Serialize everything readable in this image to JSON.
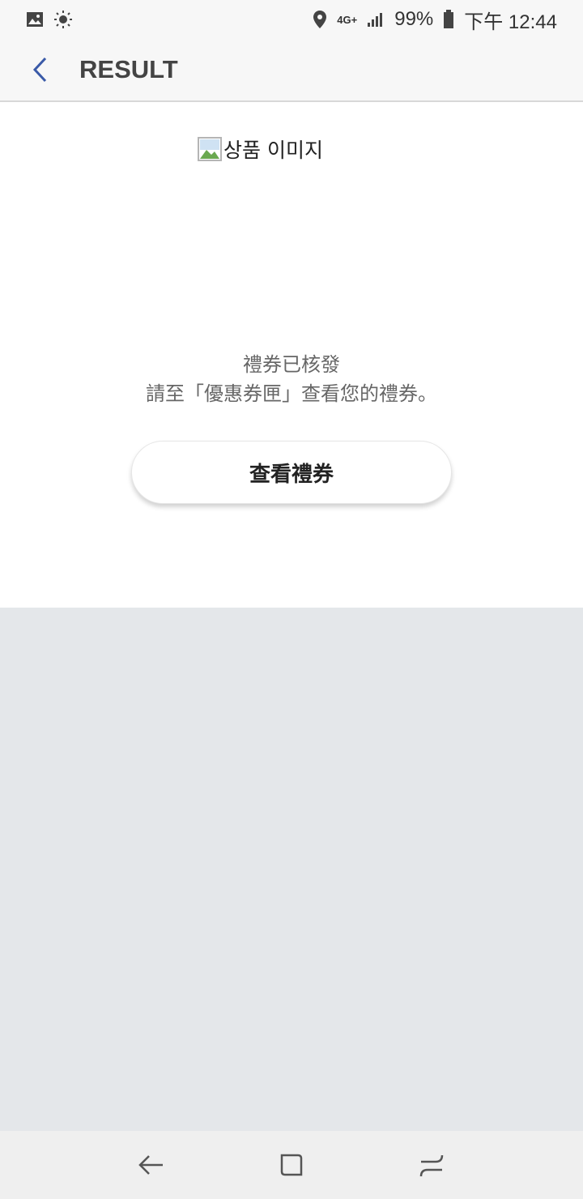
{
  "status_bar": {
    "network": "4G+",
    "battery": "99%",
    "time": "下午 12:44",
    "icons": [
      "gallery-icon",
      "brightness-icon",
      "location-icon",
      "signal-icon",
      "battery-icon"
    ]
  },
  "app_bar": {
    "title": "RESULT",
    "back_icon": "chevron-left-icon",
    "accent": "#3a5aa8"
  },
  "content": {
    "product_image_alt": "상품 이미지",
    "message_line1": "禮券已核發",
    "message_line2": "請至「優惠券匣」查看您的禮券。",
    "button_label": "查看禮券"
  },
  "nav_bar": {
    "icons": [
      "back-arrow-icon",
      "home-square-icon",
      "recents-icon"
    ]
  }
}
